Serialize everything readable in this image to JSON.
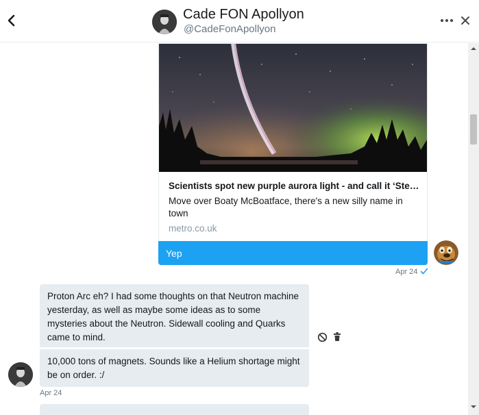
{
  "header": {
    "name": "Cade FON Apollyon",
    "handle": "@CadeFonApollyon",
    "back_icon": "chevron-left-icon",
    "more_icon": "more-dots-icon",
    "close_icon": "close-icon"
  },
  "link_card": {
    "title": "Scientists spot new purple aurora light - and call it ‘Steve’",
    "description": "Move over Boaty McBoatface, there's a new silly name in town",
    "domain": "metro.co.uk"
  },
  "sent_message": {
    "text": "Yep",
    "timestamp": "Apr 24",
    "status_icon": "check-icon"
  },
  "received_messages": [
    {
      "text": "Proton Arc eh? I had some thoughts on that Neutron machine yesterday, as well as maybe some ideas as to some mysteries about the Neutron. Sidewall cooling and Quarks came to mind."
    },
    {
      "text": "10,000 tons of magnets. Sounds like a Helium shortage might be on order. :/"
    }
  ],
  "received_timestamp": "Apr 24",
  "colors": {
    "accent": "#1da1f2",
    "received_bubble": "#e6ecf0",
    "muted_text": "#657786"
  }
}
